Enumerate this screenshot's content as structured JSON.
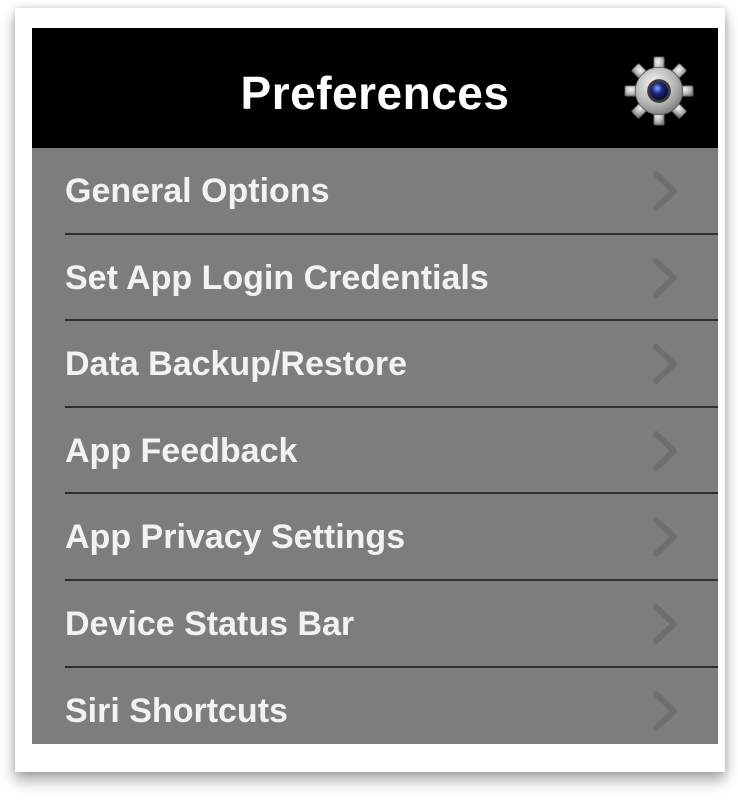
{
  "header": {
    "title": "Preferences",
    "icon": "gear-icon"
  },
  "menu": {
    "items": [
      {
        "label": "General Options"
      },
      {
        "label": "Set App Login Credentials"
      },
      {
        "label": "Data Backup/Restore"
      },
      {
        "label": "App Feedback"
      },
      {
        "label": "App Privacy Settings"
      },
      {
        "label": "Device Status Bar"
      },
      {
        "label": "Siri Shortcuts"
      }
    ],
    "item_icon": "chevron-right-icon"
  },
  "colors": {
    "header_bg": "#000000",
    "list_bg": "#7d7d7d",
    "text": "#f2f2f2",
    "divider": "#2f2f2f",
    "chevron": "#6e6e6e"
  }
}
